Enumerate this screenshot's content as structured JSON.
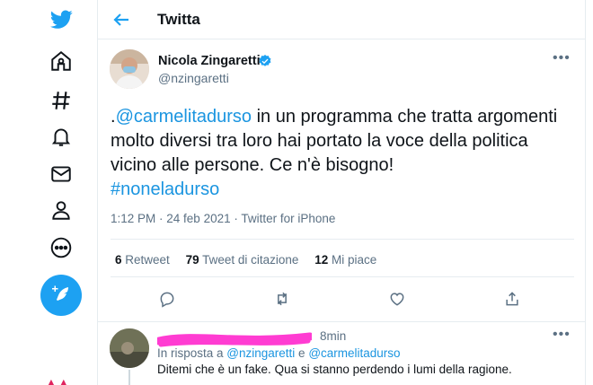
{
  "header": {
    "title": "Twitta"
  },
  "nav": {
    "items": [
      "twitter-logo",
      "home-icon",
      "explore-hashtag-icon",
      "notifications-bell-icon",
      "messages-envelope-icon",
      "profile-person-icon",
      "more-circle-icon"
    ],
    "compose_icon": "feather-plus-icon",
    "accent": "#1da1f2"
  },
  "tweet": {
    "author_name": "Nicola Zingaretti",
    "author_handle": "@nzingaretti",
    "text_prefix": ".",
    "mention": "@carmelitadurso",
    "text_body": " in un programma che tratta argomenti molto diversi tra loro hai portato la voce della politica vicino alle persone. Ce n'è bisogno!",
    "hashtag": "#noneladurso",
    "time": "1:12 PM",
    "date": "24 feb 2021",
    "source": "Twitter for iPhone",
    "meta_sep": " · ",
    "retweets_count": "6",
    "retweets_label": "Retweet",
    "quotes_count": "79",
    "quotes_label": "Tweet di citazione",
    "likes_count": "12",
    "likes_label": "Mi piace"
  },
  "reply": {
    "time": "8min",
    "context_prefix": "In risposta a ",
    "context_user1": "@nzingaretti",
    "context_and": " e ",
    "context_user2": "@carmelitadurso",
    "text": "Ditemi che è un fake. Qua si stanno perdendo i lumi della ragione."
  },
  "colors": {
    "link": "#1b95e0",
    "secondary": "#5b7083",
    "redaction": "#ff3cd2"
  }
}
